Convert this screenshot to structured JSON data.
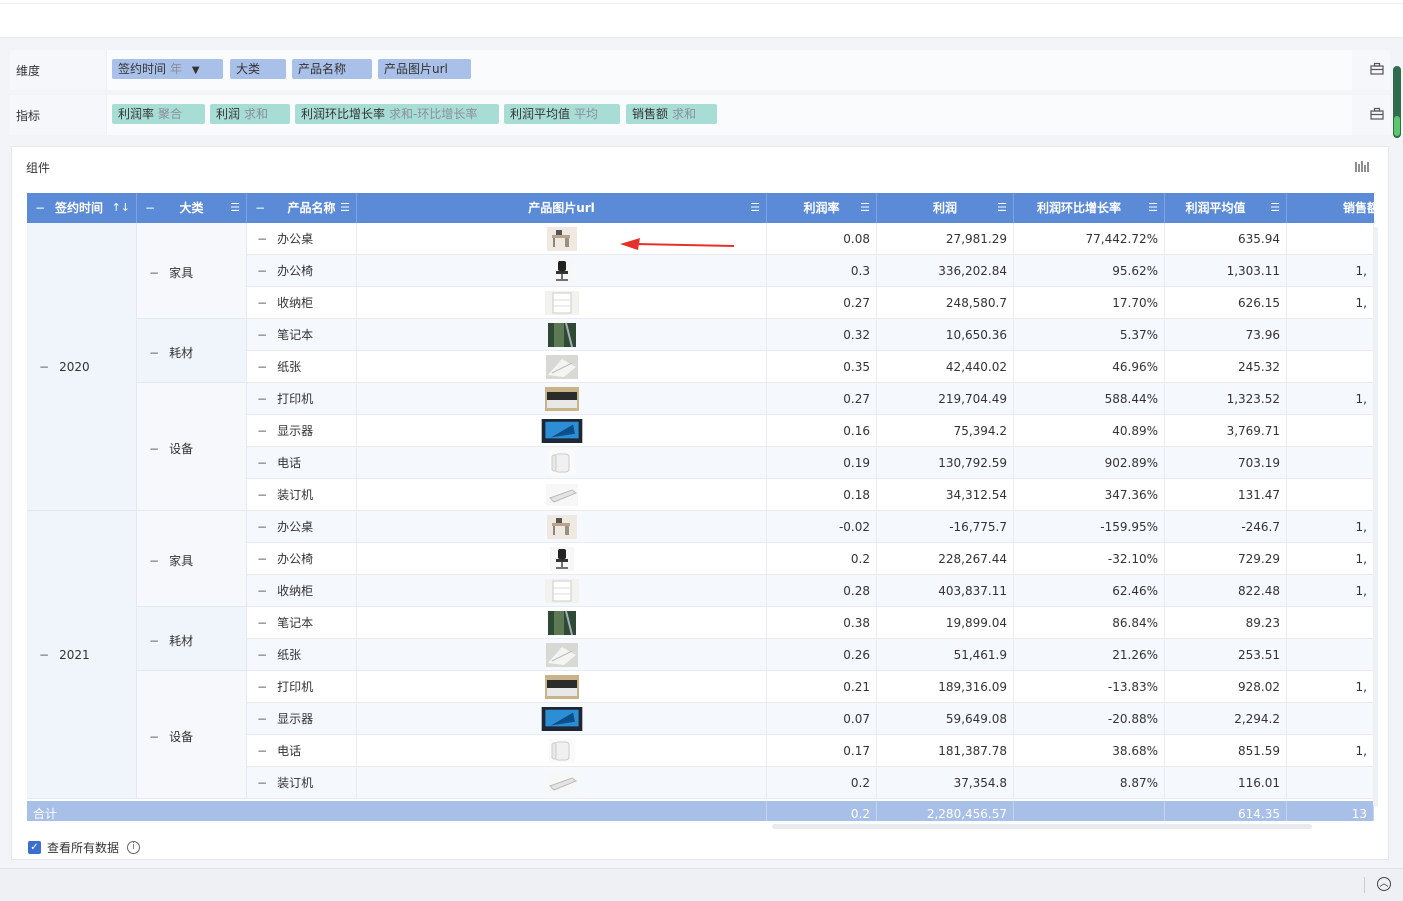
{
  "toolbar": {
    "dimension_label": "维度",
    "metric_label": "指标",
    "dimensions": [
      {
        "name": "签约时间",
        "sub": "年",
        "filter": true
      },
      {
        "name": "大类",
        "sub": ""
      },
      {
        "name": "产品名称",
        "sub": ""
      },
      {
        "name": "产品图片url",
        "sub": ""
      }
    ],
    "metrics": [
      {
        "name": "利润率",
        "sub": "聚合"
      },
      {
        "name": "利润",
        "sub": "求和"
      },
      {
        "name": "利润环比增长率",
        "sub": "求和-环比增长率"
      },
      {
        "name": "利润平均值",
        "sub": "平均"
      },
      {
        "name": "销售额",
        "sub": "求和"
      }
    ]
  },
  "panel": {
    "title": "组件",
    "view_all_label": "查看所有数据",
    "view_all_checked": true
  },
  "table": {
    "columns": [
      "签约时间",
      "大类",
      "产品名称",
      "产品图片url",
      "利润率",
      "利润",
      "利润环比增长率",
      "利润平均值",
      "销售额"
    ],
    "rows": [
      {
        "year": "2020",
        "category": "家具",
        "product": "办公桌",
        "image": "desk-photo",
        "margin": "0.08",
        "profit": "27,981.29",
        "growth": "77,442.72%",
        "avg": "635.94",
        "sales": ""
      },
      {
        "year": "2020",
        "category": "家具",
        "product": "办公椅",
        "image": "chair-photo",
        "margin": "0.3",
        "profit": "336,202.84",
        "growth": "95.62%",
        "avg": "1,303.11",
        "sales": "1,"
      },
      {
        "year": "2020",
        "category": "家具",
        "product": "收纳柜",
        "image": "cabinet-photo",
        "margin": "0.27",
        "profit": "248,580.7",
        "growth": "17.70%",
        "avg": "626.15",
        "sales": "1,"
      },
      {
        "year": "2020",
        "category": "耗材",
        "product": "笔记本",
        "image": "notebook-photo",
        "margin": "0.32",
        "profit": "10,650.36",
        "growth": "5.37%",
        "avg": "73.96",
        "sales": ""
      },
      {
        "year": "2020",
        "category": "耗材",
        "product": "纸张",
        "image": "paper-photo",
        "margin": "0.35",
        "profit": "42,440.02",
        "growth": "46.96%",
        "avg": "245.32",
        "sales": ""
      },
      {
        "year": "2020",
        "category": "设备",
        "product": "打印机",
        "image": "printer-photo",
        "margin": "0.27",
        "profit": "219,704.49",
        "growth": "588.44%",
        "avg": "1,323.52",
        "sales": "1,"
      },
      {
        "year": "2020",
        "category": "设备",
        "product": "显示器",
        "image": "monitor-photo",
        "margin": "0.16",
        "profit": "75,394.2",
        "growth": "40.89%",
        "avg": "3,769.71",
        "sales": ""
      },
      {
        "year": "2020",
        "category": "设备",
        "product": "电话",
        "image": "phone-photo",
        "margin": "0.19",
        "profit": "130,792.59",
        "growth": "902.89%",
        "avg": "703.19",
        "sales": ""
      },
      {
        "year": "2020",
        "category": "设备",
        "product": "装订机",
        "image": "binder-photo",
        "margin": "0.18",
        "profit": "34,312.54",
        "growth": "347.36%",
        "avg": "131.47",
        "sales": ""
      },
      {
        "year": "2021",
        "category": "家具",
        "product": "办公桌",
        "image": "desk-photo",
        "margin": "-0.02",
        "profit": "-16,775.7",
        "growth": "-159.95%",
        "avg": "-246.7",
        "sales": "1,"
      },
      {
        "year": "2021",
        "category": "家具",
        "product": "办公椅",
        "image": "chair-photo",
        "margin": "0.2",
        "profit": "228,267.44",
        "growth": "-32.10%",
        "avg": "729.29",
        "sales": "1,"
      },
      {
        "year": "2021",
        "category": "家具",
        "product": "收纳柜",
        "image": "cabinet-photo",
        "margin": "0.28",
        "profit": "403,837.11",
        "growth": "62.46%",
        "avg": "822.48",
        "sales": "1,"
      },
      {
        "year": "2021",
        "category": "耗材",
        "product": "笔记本",
        "image": "notebook-photo",
        "margin": "0.38",
        "profit": "19,899.04",
        "growth": "86.84%",
        "avg": "89.23",
        "sales": ""
      },
      {
        "year": "2021",
        "category": "耗材",
        "product": "纸张",
        "image": "paper-photo",
        "margin": "0.26",
        "profit": "51,461.9",
        "growth": "21.26%",
        "avg": "253.51",
        "sales": ""
      },
      {
        "year": "2021",
        "category": "设备",
        "product": "打印机",
        "image": "printer-photo",
        "margin": "0.21",
        "profit": "189,316.09",
        "growth": "-13.83%",
        "avg": "928.02",
        "sales": "1,"
      },
      {
        "year": "2021",
        "category": "设备",
        "product": "显示器",
        "image": "monitor-photo",
        "margin": "0.07",
        "profit": "59,649.08",
        "growth": "-20.88%",
        "avg": "2,294.2",
        "sales": ""
      },
      {
        "year": "2021",
        "category": "设备",
        "product": "电话",
        "image": "phone-photo",
        "margin": "0.17",
        "profit": "181,387.78",
        "growth": "38.68%",
        "avg": "851.59",
        "sales": "1,"
      },
      {
        "year": "2021",
        "category": "设备",
        "product": "装订机",
        "image": "binder-photo",
        "margin": "0.2",
        "profit": "37,354.8",
        "growth": "8.87%",
        "avg": "116.01",
        "sales": ""
      }
    ],
    "total": {
      "label": "合计",
      "margin": "0.2",
      "profit": "2,280,456.57",
      "avg": "614.35",
      "sales": "13"
    }
  },
  "colors": {
    "header": "#5b8ad6",
    "dimension_chip": "#a9c0e8",
    "metric_chip": "#a8ddd6",
    "annotation_arrow": "#e8302a"
  }
}
